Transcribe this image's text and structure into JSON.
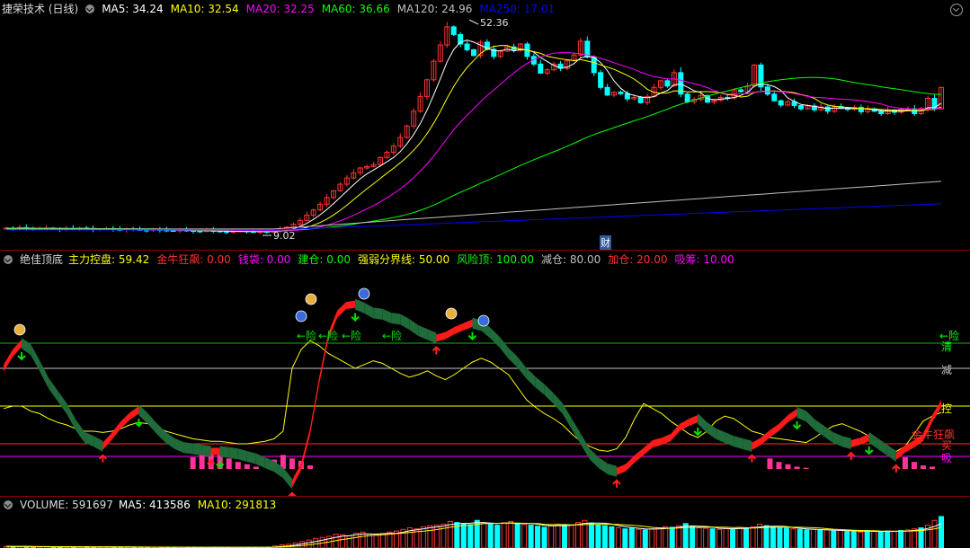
{
  "price_panel": {
    "title": "捷荣技术 (日线)",
    "ma_items": [
      {
        "label": "MA5: 34.24",
        "color": "#ffffff"
      },
      {
        "label": "MA10: 32.54",
        "color": "#ffff00"
      },
      {
        "label": "MA20: 32.25",
        "color": "#ff00ff"
      },
      {
        "label": "MA60: 36.66",
        "color": "#00ff00"
      },
      {
        "label": "MA120: 24.96",
        "color": "#c0c0c0"
      },
      {
        "label": "MA250: 17.01",
        "color": "#0000ff"
      }
    ],
    "high_label": "52.36",
    "low_label": "9.02",
    "event_badge": "财"
  },
  "indicator_panel": {
    "title": "绝佳顶底",
    "items": [
      {
        "label": "主力控盘: 59.42",
        "color": "#ffff00"
      },
      {
        "label": "金牛狂飙: 0.00",
        "color": "#ff3030"
      },
      {
        "label": "钱袋: 0.00",
        "color": "#ff00ff"
      },
      {
        "label": "建仓: 0.00",
        "color": "#00ff00"
      },
      {
        "label": "强弱分界线: 50.00",
        "color": "#ffff00"
      },
      {
        "label": "风险顶: 100.00",
        "color": "#00ff00"
      },
      {
        "label": "减仓: 80.00",
        "color": "#c0c0c0"
      },
      {
        "label": "加仓: 20.00",
        "color": "#ff3030"
      },
      {
        "label": "吸筹: 10.00",
        "color": "#ff00ff"
      }
    ],
    "right_labels": [
      {
        "text": "←险",
        "color": "#00ff00"
      },
      {
        "text": "清",
        "color": "#00ff00"
      },
      {
        "text": "减",
        "color": "#c0c0c0"
      },
      {
        "text": "控",
        "color": "#ffff00"
      },
      {
        "text": "金牛狂飙",
        "color": "#ff3030"
      },
      {
        "text": "买",
        "color": "#ff3030"
      },
      {
        "text": "吸",
        "color": "#ff00ff"
      }
    ],
    "risk_marks": [
      "←险",
      "←险",
      "←险",
      "←险"
    ]
  },
  "volume_panel": {
    "title": "VOLUME: 591697",
    "items": [
      {
        "label": "MA5: 413586",
        "color": "#ffffff"
      },
      {
        "label": "MA10: 291813",
        "color": "#ffff00"
      }
    ]
  },
  "chart_data": [
    {
      "type": "candlestick",
      "ylim": [
        9.02,
        52.36
      ],
      "annotations": [
        "52.36",
        "9.02",
        "财"
      ],
      "series": [
        {
          "name": "MA5",
          "color": "#ffffff"
        },
        {
          "name": "MA10",
          "color": "#ffff00"
        },
        {
          "name": "MA20",
          "color": "#ff00ff"
        },
        {
          "name": "MA60",
          "color": "#00ff00"
        },
        {
          "name": "MA120",
          "color": "#c0c0c0"
        },
        {
          "name": "MA250",
          "color": "#0000ff"
        }
      ],
      "closes": [
        9.8,
        9.7,
        9.9,
        9.8,
        9.6,
        9.7,
        9.8,
        9.6,
        9.5,
        9.7,
        9.6,
        9.8,
        9.7,
        9.5,
        9.6,
        9.7,
        9.5,
        9.4,
        9.6,
        9.5,
        9.4,
        9.3,
        9.5,
        9.4,
        9.3,
        9.2,
        9.4,
        9.3,
        9.2,
        9.1,
        9.3,
        9.2,
        9.1,
        9.0,
        9.1,
        9.2,
        9.1,
        9.0,
        9.1,
        9.0,
        9.2,
        9.5,
        10.0,
        10.6,
        11.4,
        12.5,
        13.6,
        14.8,
        16.2,
        17.6,
        19.0,
        20.3,
        21.4,
        22.4,
        22.7,
        23.1,
        24.6,
        25.7,
        27.0,
        28.8,
        31.2,
        34.3,
        37.4,
        40.9,
        44.8,
        48.2,
        52.0,
        50.4,
        48.4,
        47.2,
        46.0,
        48.8,
        47.3,
        45.8,
        46.9,
        47.8,
        47.1,
        48.4,
        45.8,
        44.2,
        42.3,
        43.0,
        44.2,
        43.3,
        44.9,
        46.1,
        49.0,
        45.7,
        42.4,
        39.3,
        37.7,
        38.3,
        38.0,
        36.9,
        37.2,
        36.1,
        37.4,
        39.3,
        40.7,
        39.6,
        42.4,
        37.9,
        36.3,
        36.8,
        37.6,
        36.2,
        36.6,
        37.2,
        37.1,
        38.8,
        38.4,
        39.6,
        44.0,
        39.4,
        37.9,
        36.5,
        35.6,
        36.3,
        35.5,
        34.8,
        35.4,
        34.6,
        35.2,
        34.3,
        35.3,
        35.0,
        34.7,
        35.1,
        34.2,
        34.8,
        34.3,
        33.8,
        34.5,
        34.1,
        34.7,
        34.8,
        33.8,
        34.9,
        37.0,
        34.8,
        39.3
      ]
    },
    {
      "type": "area",
      "ylim": [
        0,
        100
      ],
      "reference_lines": [
        {
          "name": "风险顶",
          "value": 100
        },
        {
          "name": "减仓",
          "value": 80
        },
        {
          "name": "强弱分界线",
          "value": 50
        },
        {
          "name": "加仓",
          "value": 20
        },
        {
          "name": "吸筹",
          "value": 10
        }
      ],
      "series": [
        {
          "name": "主力控盘",
          "color": "#ffff00"
        },
        {
          "name": "钱袋",
          "color": "#ff3399"
        }
      ],
      "band": [
        80,
        92,
        100,
        95,
        82,
        68,
        58,
        48,
        35,
        25,
        22,
        18,
        26,
        35,
        42,
        47,
        40,
        32,
        25,
        20,
        17,
        16,
        15,
        14,
        14,
        13,
        12,
        10,
        8,
        5,
        2,
        -3,
        -12,
        2,
        30,
        70,
        105,
        123,
        130,
        131,
        128,
        124,
        123,
        120,
        119,
        115,
        110,
        107,
        104,
        106,
        110,
        113,
        116,
        114,
        108,
        101,
        92,
        85,
        76,
        69,
        63,
        56,
        48,
        36,
        24,
        12,
        5,
        0,
        -2,
        1,
        8,
        14,
        20,
        22,
        25,
        33,
        37,
        40,
        33,
        28,
        25,
        22,
        20,
        18,
        22,
        28,
        33,
        40,
        45,
        42,
        35,
        30,
        25,
        22,
        20,
        22,
        25,
        20,
        15,
        10,
        16,
        20,
        25,
        40,
        52
      ],
      "main_control": [
        48,
        50,
        50,
        46,
        44,
        40,
        37,
        35,
        32,
        30,
        30,
        29,
        30,
        32,
        35,
        37,
        36,
        33,
        30,
        28,
        26,
        24,
        23,
        22,
        22,
        21,
        20,
        20,
        21,
        22,
        24,
        30,
        80,
        95,
        102,
        98,
        92,
        88,
        84,
        80,
        83,
        86,
        84,
        80,
        76,
        73,
        75,
        78,
        74,
        71,
        75,
        80,
        85,
        88,
        85,
        80,
        75,
        65,
        55,
        49,
        44,
        40,
        35,
        28,
        22,
        18,
        15,
        14,
        16,
        25,
        40,
        52,
        48,
        44,
        38,
        33,
        28,
        25,
        30,
        38,
        42,
        40,
        35,
        30,
        28,
        25,
        24,
        23,
        22,
        21,
        25,
        30,
        34,
        36,
        33,
        30,
        26,
        22,
        18,
        14,
        18,
        28,
        38,
        42,
        45
      ],
      "money_bag": [
        0,
        0,
        0,
        0,
        0,
        0,
        0,
        0,
        0,
        0,
        0,
        0,
        0,
        0,
        0,
        0,
        0,
        0,
        0,
        0,
        0,
        10,
        12,
        14,
        12,
        9,
        6,
        4,
        2,
        0,
        8,
        12,
        9,
        7,
        3,
        0,
        0,
        0,
        0,
        0,
        0,
        0,
        0,
        0,
        0,
        0,
        0,
        0,
        0,
        0,
        0,
        0,
        0,
        0,
        0,
        0,
        0,
        0,
        0,
        0,
        0,
        0,
        0,
        0,
        0,
        0,
        0,
        0,
        0,
        0,
        0,
        0,
        0,
        0,
        0,
        0,
        0,
        0,
        0,
        0,
        0,
        0,
        0,
        0,
        0,
        9,
        6,
        4,
        2,
        1,
        0,
        0,
        0,
        0,
        0,
        0,
        0,
        0,
        0,
        0,
        10,
        6,
        3,
        2,
        0
      ]
    },
    {
      "type": "bar",
      "series": [
        {
          "name": "VOLUME",
          "color": "#00ffff"
        },
        {
          "name": "MA5",
          "color": "#ffffff"
        },
        {
          "name": "MA10",
          "color": "#ffff00"
        }
      ],
      "values": [
        30000,
        28000,
        26000,
        30000,
        24000,
        22000,
        25000,
        21000,
        20000,
        23000,
        19000,
        24000,
        22000,
        18000,
        21000,
        20000,
        17000,
        16000,
        19000,
        18000,
        15000,
        14000,
        16000,
        17000,
        13000,
        12000,
        15000,
        14000,
        12000,
        11000,
        13000,
        15000,
        14000,
        12000,
        13000,
        15000,
        14000,
        12000,
        13000,
        15000,
        40000,
        60000,
        70000,
        95000,
        120000,
        150000,
        180000,
        200000,
        220000,
        260000,
        250000,
        230000,
        280000,
        300000,
        260000,
        240000,
        270000,
        300000,
        320000,
        350000,
        380000,
        360000,
        400000,
        420000,
        430000,
        450000,
        500000,
        480000,
        460000,
        440000,
        520000,
        480000,
        450000,
        430000,
        470000,
        500000,
        460000,
        440000,
        430000,
        410000,
        390000,
        420000,
        450000,
        440000,
        430000,
        480000,
        520000,
        470000,
        440000,
        420000,
        400000,
        380000,
        360000,
        370000,
        350000,
        340000,
        360000,
        380000,
        400000,
        390000,
        420000,
        460000,
        400000,
        380000,
        370000,
        360000,
        350000,
        370000,
        360000,
        390000,
        380000,
        400000,
        450000,
        420000,
        400000,
        380000,
        370000,
        360000,
        350000,
        340000,
        350000,
        330000,
        340000,
        320000,
        330000,
        310000,
        320000,
        300000,
        330000,
        310000,
        300000,
        320000,
        310000,
        330000,
        340000,
        360000,
        380000,
        430000,
        520000,
        591697
      ]
    }
  ]
}
